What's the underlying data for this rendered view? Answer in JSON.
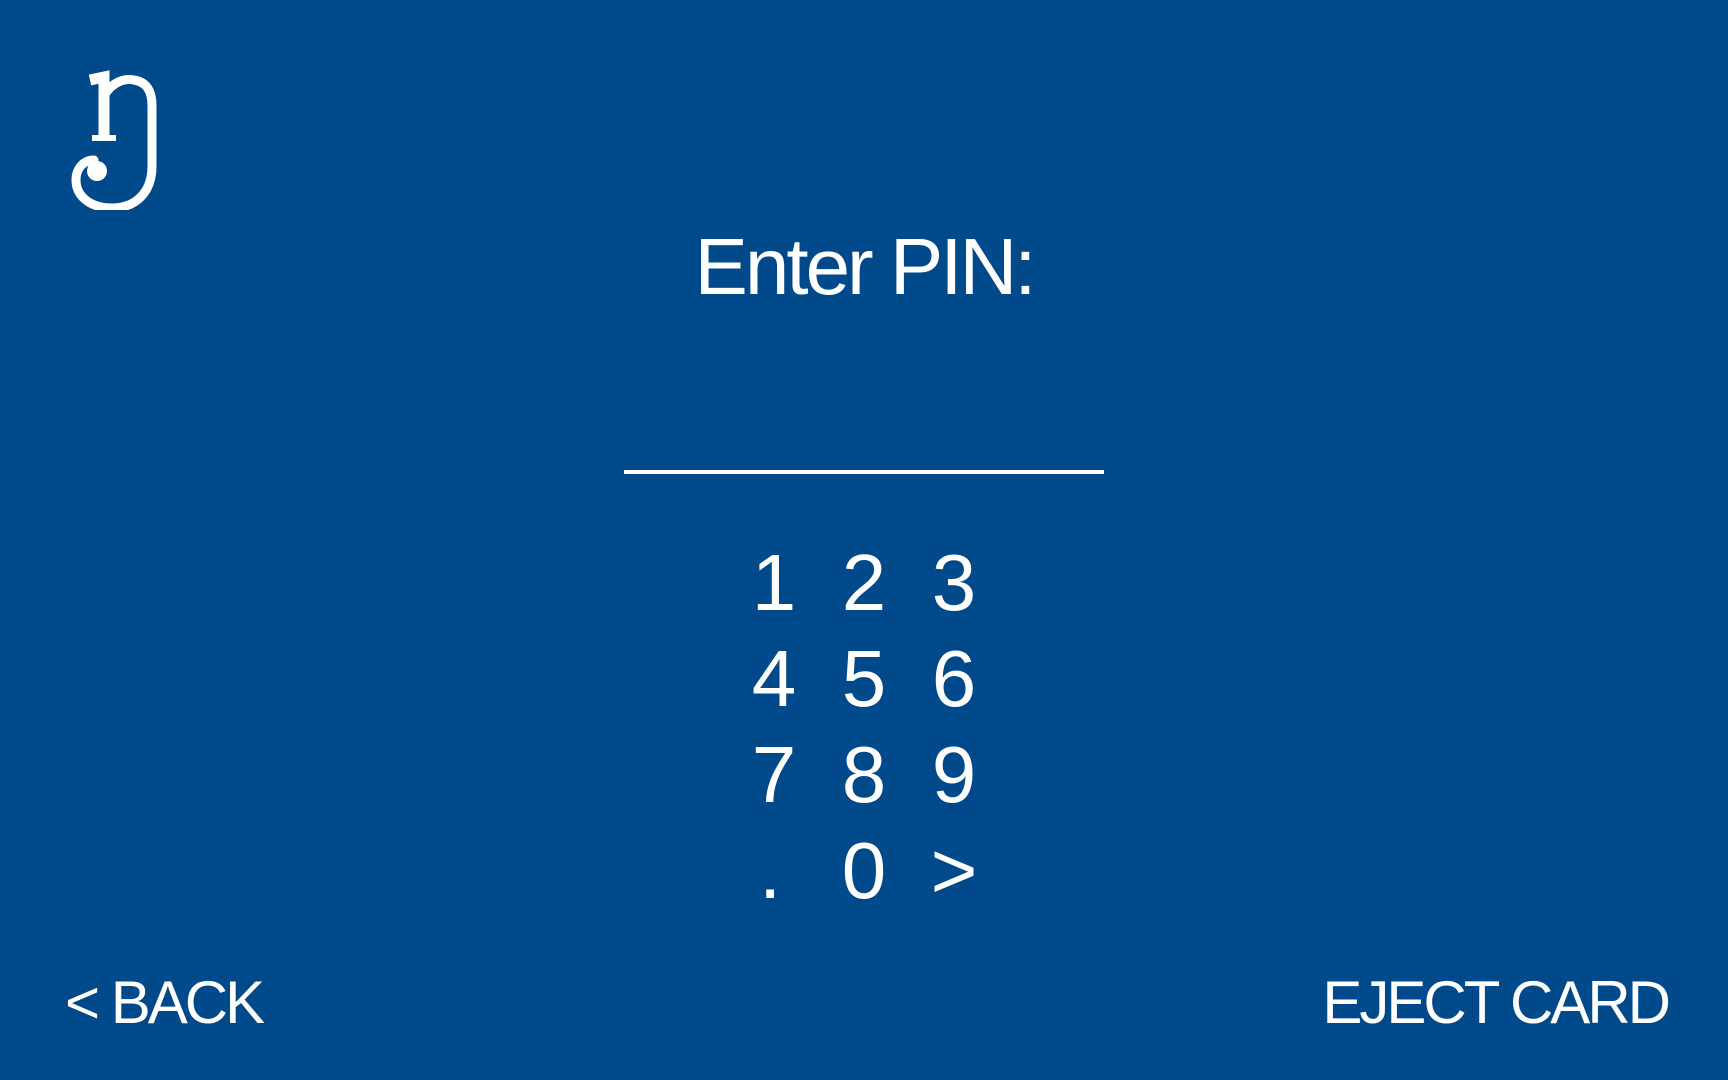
{
  "theme": {
    "background": "#004a8c",
    "foreground": "#ffffff"
  },
  "logo": {
    "icon": "bank-logo-icon"
  },
  "title": "Enter PIN:",
  "pin_field": {
    "value": ""
  },
  "keypad": {
    "keys": [
      "1",
      "2",
      "3",
      "4",
      "5",
      "6",
      "7",
      "8",
      "9",
      ".",
      "0",
      ">"
    ]
  },
  "footer": {
    "back_label": "< BACK",
    "eject_label": "EJECT CARD"
  }
}
